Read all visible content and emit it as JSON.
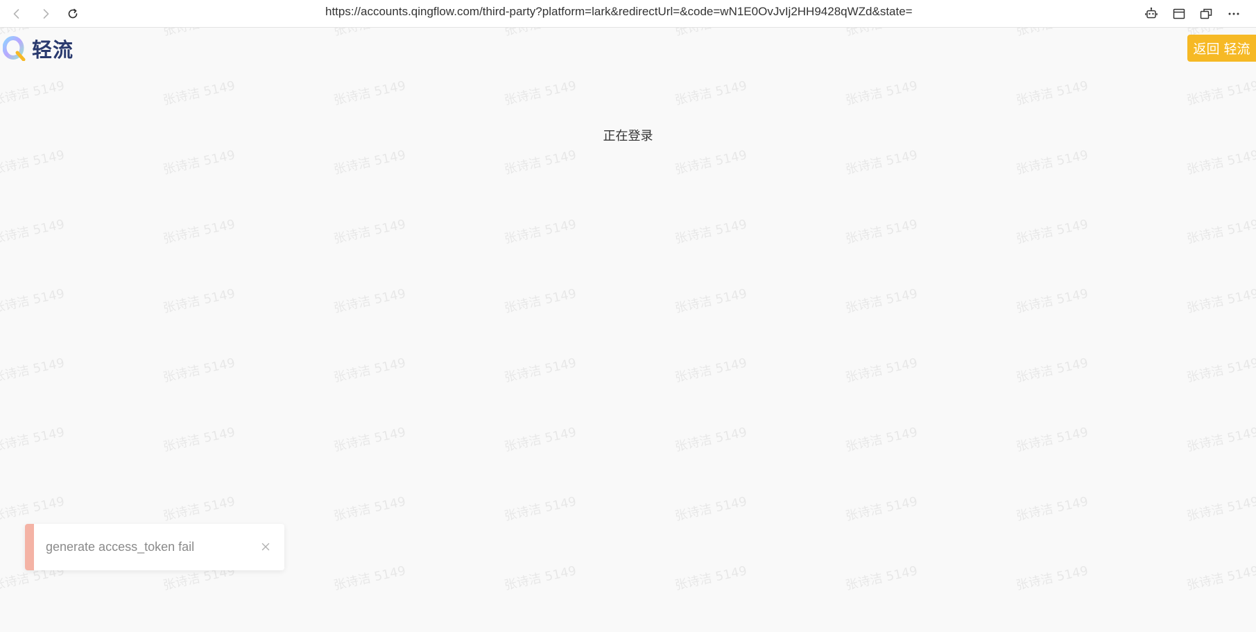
{
  "browser": {
    "url": "https://accounts.qingflow.com/third-party?platform=lark&redirectUrl=&code=wN1E0OvJvIj2HH9428qWZd&state="
  },
  "page": {
    "logo_text": "轻流",
    "return_label": "返回 轻流",
    "status": "正在登录",
    "watermark": "张诗洁 5149",
    "toast": {
      "message": "generate access_token fail"
    }
  },
  "colors": {
    "accent": "#f6b925",
    "error_bar": "#f4b3a5",
    "background": "#f9f9f9"
  },
  "icons": {
    "back": "chevron-left-icon",
    "forward": "chevron-right-icon",
    "reload": "reload-icon",
    "robot": "robot-icon",
    "window": "window-icon",
    "split": "split-window-icon",
    "more": "more-icon",
    "close": "close-icon"
  }
}
